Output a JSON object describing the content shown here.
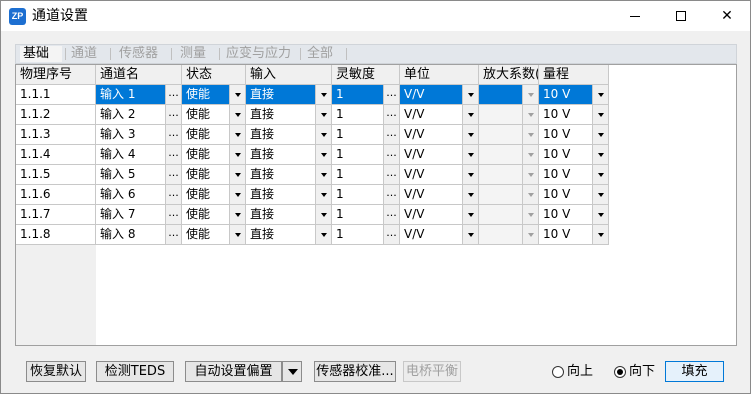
{
  "window": {
    "title": "通道设置",
    "icon": "zp-app-icon"
  },
  "tabs": [
    "基础",
    "通道",
    "传感器",
    "测量",
    "应变与应力",
    "全部"
  ],
  "active_tab": 0,
  "columns": [
    "物理序号",
    "通道名",
    "状态",
    "输入",
    "灵敏度",
    "单位",
    "放大系数(",
    "量程"
  ],
  "rows": [
    {
      "id": "1.1.1",
      "name": "输入 1",
      "status": "使能",
      "input": "直接",
      "sensitivity": "1",
      "unit": "V/V",
      "gain": "",
      "range": "10 V"
    },
    {
      "id": "1.1.2",
      "name": "输入 2",
      "status": "使能",
      "input": "直接",
      "sensitivity": "1",
      "unit": "V/V",
      "gain": "",
      "range": "10 V"
    },
    {
      "id": "1.1.3",
      "name": "输入 3",
      "status": "使能",
      "input": "直接",
      "sensitivity": "1",
      "unit": "V/V",
      "gain": "",
      "range": "10 V"
    },
    {
      "id": "1.1.4",
      "name": "输入 4",
      "status": "使能",
      "input": "直接",
      "sensitivity": "1",
      "unit": "V/V",
      "gain": "",
      "range": "10 V"
    },
    {
      "id": "1.1.5",
      "name": "输入 5",
      "status": "使能",
      "input": "直接",
      "sensitivity": "1",
      "unit": "V/V",
      "gain": "",
      "range": "10 V"
    },
    {
      "id": "1.1.6",
      "name": "输入 6",
      "status": "使能",
      "input": "直接",
      "sensitivity": "1",
      "unit": "V/V",
      "gain": "",
      "range": "10 V"
    },
    {
      "id": "1.1.7",
      "name": "输入 7",
      "status": "使能",
      "input": "直接",
      "sensitivity": "1",
      "unit": "V/V",
      "gain": "",
      "range": "10 V"
    },
    {
      "id": "1.1.8",
      "name": "输入 8",
      "status": "使能",
      "input": "直接",
      "sensitivity": "1",
      "unit": "V/V",
      "gain": "",
      "range": "10 V"
    }
  ],
  "selected_row": 0,
  "buttons": {
    "restore_default": "恢复默认",
    "detect_teds": "检测TEDS",
    "auto_offset": "自动设置偏置",
    "sensor_calibrate": "传感器校准...",
    "bridge_balance": "电桥平衡",
    "fill": "填充"
  },
  "fill_direction": {
    "up": "向上",
    "down": "向下",
    "selected": "down"
  },
  "colors": {
    "selection": "#0078d7",
    "accent": "#0078d7"
  }
}
